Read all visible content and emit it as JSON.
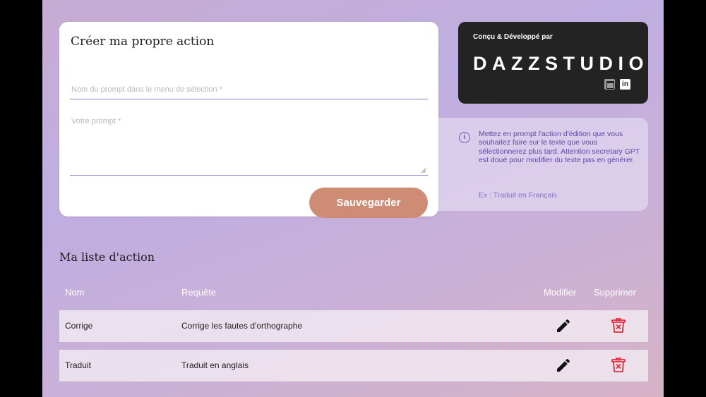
{
  "create": {
    "title": "Créer ma propre action",
    "name_placeholder": "Nom du prompt dans le menu de sélection *",
    "prompt_placeholder": "Votre prompt *",
    "save_label": "Sauvegarder"
  },
  "brand": {
    "caption": "Conçu & Développé par",
    "logo_text": "DAZZSTUDIO",
    "icons": [
      "website-icon",
      "linkedin-icon"
    ],
    "li_glyph": "in"
  },
  "info": {
    "icon": "info-icon",
    "icon_glyph": "i",
    "text": "Mettez en prompt l'action d'édition que vous souhaitez faire sur le texte que vous sélectionnerez plus tard. Attention secretary GPT est doué pour modifier du texte pas en générer.",
    "example": "Ex : Traduit en Français"
  },
  "list": {
    "title": "Ma liste d'action",
    "headers": {
      "name": "Nom",
      "request": "Requête",
      "edit": "Modifier",
      "delete": "Supprimer"
    },
    "rows": [
      {
        "name": "Corrige",
        "request": "Corrige les fautes d'orthographe"
      },
      {
        "name": "Traduit",
        "request": "Traduit en anglais"
      }
    ]
  },
  "colors": {
    "accent_button": "#cf8c75",
    "field_underline": "#8c7fd6",
    "info_text": "#5a4aa8",
    "delete_icon": "#e02d3c",
    "brand_bg": "#232323"
  }
}
